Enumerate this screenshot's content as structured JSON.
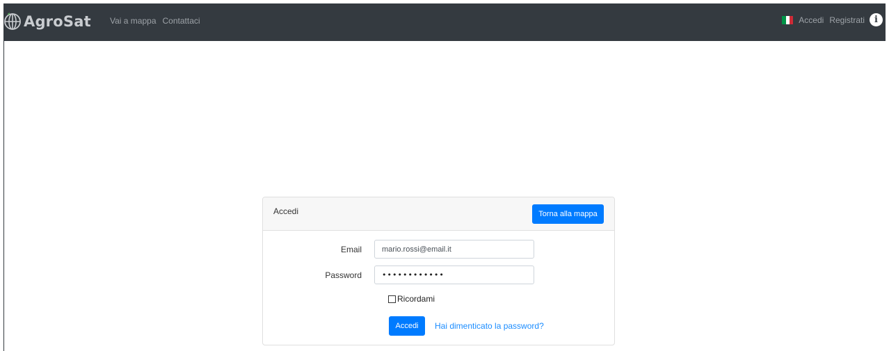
{
  "navbar": {
    "brand": "AgroSat",
    "links": [
      "Vai a mappa",
      "Contattaci"
    ],
    "right": {
      "login": "Accedi",
      "register": "Registrati",
      "flag_colors": [
        "#009246",
        "#ffffff",
        "#ce2b37"
      ]
    }
  },
  "login_card": {
    "title": "Accedi",
    "back_button": "Torna alla mappa",
    "email_label": "Email",
    "email_value": "mario.rossi@email.it",
    "password_label": "Password",
    "password_value": "••••••••••••",
    "remember_label": "Ricordami",
    "submit_button": "Accedi",
    "forgot_link": "Hai dimenticato la password?"
  },
  "colors": {
    "navbar_bg": "#343a40",
    "primary": "#007bff",
    "link": "#1a8cff"
  }
}
